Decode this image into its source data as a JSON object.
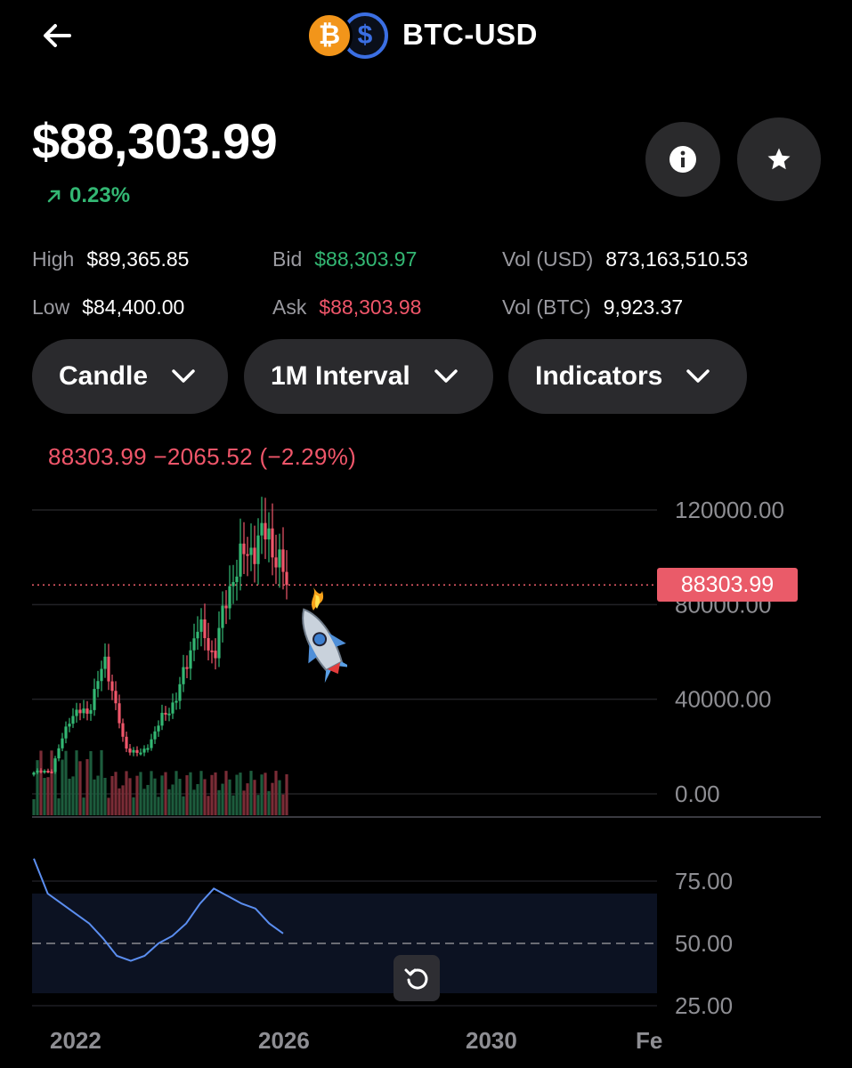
{
  "header": {
    "title": "BTC-USD",
    "back_icon": "arrow-left-icon",
    "base_icon": "bitcoin-icon",
    "quote_icon": "dollar-icon"
  },
  "price": {
    "value": "$88,303.99",
    "change": "0.23%",
    "change_color": "#33b773"
  },
  "stats": {
    "high_label": "High",
    "high_value": "$89,365.85",
    "low_label": "Low",
    "low_value": "$84,400.00",
    "bid_label": "Bid",
    "bid_value": "$88,303.97",
    "ask_label": "Ask",
    "ask_value": "$88,303.98",
    "vol_usd_label": "Vol (USD)",
    "vol_usd_value": "873,163,510.53",
    "vol_btc_label": "Vol (BTC)",
    "vol_btc_value": "9,923.37"
  },
  "controls": {
    "chart_type": "Candle",
    "interval": "1M Interval",
    "indicators": "Indicators"
  },
  "chart": {
    "ohlc_readout": "88303.99  −2065.52 (−2.29%)",
    "price_tag": "88303.99",
    "price_axis": [
      "120000.00",
      "80000.00",
      "40000.00",
      "0.00"
    ],
    "rsi_axis": [
      "75.00",
      "50.00",
      "25.00"
    ],
    "time_axis": [
      "2022",
      "2026",
      "2030",
      "Fe"
    ]
  },
  "chart_data": {
    "type": "candlestick",
    "x": [
      "2020-01",
      "2020-06",
      "2021-01",
      "2021-06",
      "2021-11",
      "2022-06",
      "2022-12",
      "2023-06",
      "2023-12",
      "2024-03",
      "2024-08",
      "2024-12",
      "2025-05",
      "2025-10",
      "2025-12"
    ],
    "close": [
      9000,
      10000,
      33000,
      35000,
      57000,
      20000,
      16500,
      30500,
      42000,
      71000,
      59000,
      93000,
      104000,
      110000,
      88303.99
    ],
    "ylim": [
      0,
      120000
    ],
    "last_price": 88303.99,
    "rsi": {
      "values": [
        84,
        70,
        66,
        62,
        58,
        52,
        45,
        43,
        45,
        50,
        53,
        58,
        66,
        72,
        69,
        66,
        64,
        58,
        54
      ],
      "ylim": [
        25,
        85
      ],
      "band": [
        30,
        70
      ],
      "midline": 50
    }
  },
  "colors": {
    "up": "#33b773",
    "down": "#f0566a",
    "rsi_line": "#5b8ef0",
    "accent": "#ea5b69"
  }
}
